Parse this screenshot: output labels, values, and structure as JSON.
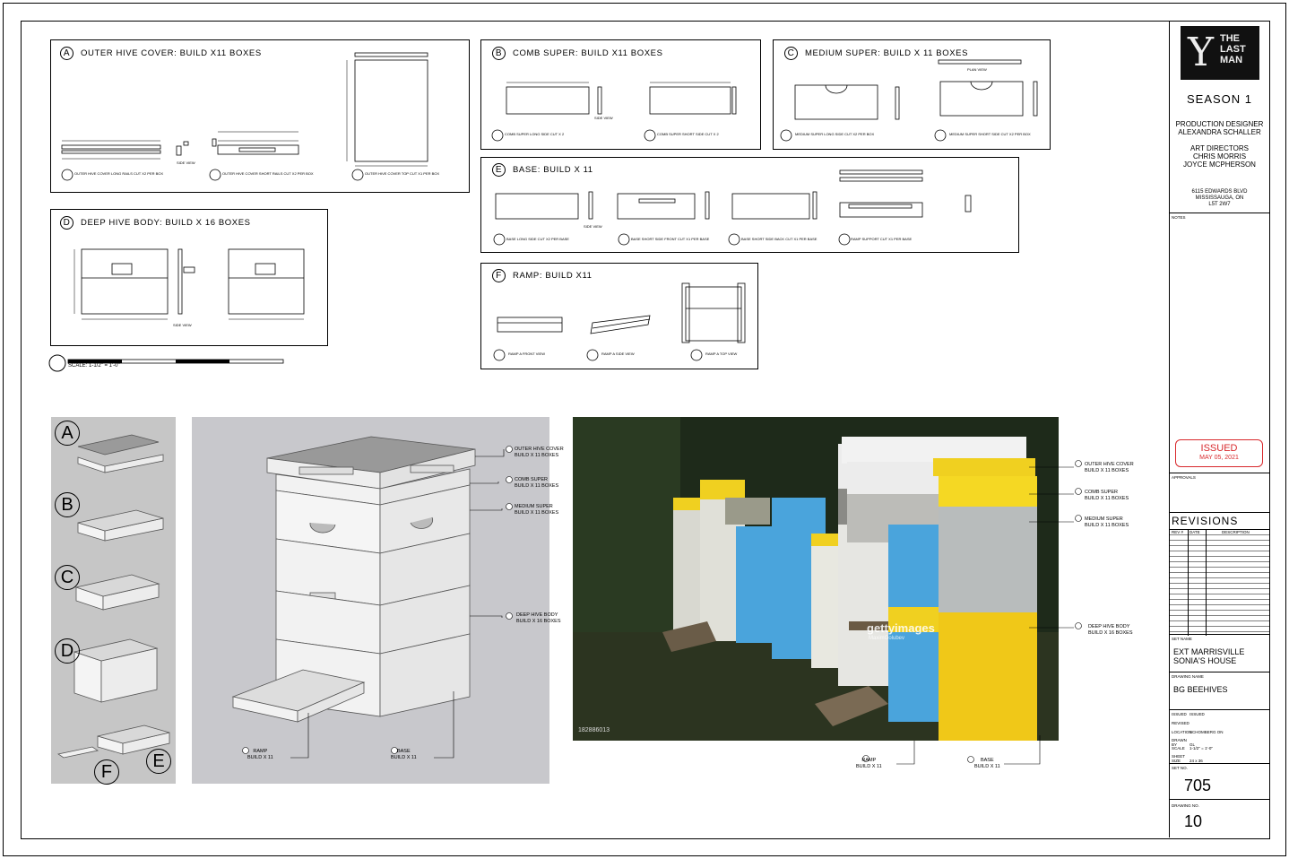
{
  "panels": {
    "a": {
      "letter": "A",
      "title": "OUTER HIVE COVER: BUILD X11 BOXES",
      "captions": [
        "OUTER HIVE COVER LONG RAILS CUT X2 PER BOX",
        "OUTER HIVE COVER SHORT RAILS CUT X2 PER BOX",
        "OUTER HIVE COVER TOP CUT X1 PER BOX"
      ],
      "side_view": "SIDE VIEW"
    },
    "b": {
      "letter": "B",
      "title": "COMB SUPER:  BUILD X11 BOXES",
      "captions": [
        "COMB SUPER LONG SIDE CUT X 2",
        "COMB SUPER SHORT SIDE CUT X 2"
      ],
      "side_view": "SIDE VIEW"
    },
    "c": {
      "letter": "C",
      "title": "MEDIUM SUPER: BUILD X 11 BOXES",
      "captions": [
        "MEDIUM SUPER LONG SIDE CUT X2 PER BOX",
        "MEDIUM SUPER SHORT SIDE CUT X2 PER BOX"
      ],
      "plan_view": "PLAN VIEW",
      "side_view": "SIDE VIEW"
    },
    "d": {
      "letter": "D",
      "title": "DEEP HIVE BODY: BUILD X 16 BOXES",
      "side_view": "SIDE VIEW"
    },
    "e": {
      "letter": "E",
      "title": "BASE:  BUILD X 11",
      "captions": [
        "BASE LONG SIDE CUT X2 PER BASE",
        "BASE SHORT SIDE FRONT CUT X1 PER BASE",
        "BASE SHORT SIDE BACK CUT X1 PER BASE",
        "RAMP SUPPORT CUT X1 PER BASE"
      ],
      "side_view": "SIDE VIEW"
    },
    "f": {
      "letter": "F",
      "title": "RAMP:  BUILD X11",
      "captions": [
        "RAMP A FRONT VIEW",
        "RAMP A SIDE VIEW",
        "RAMP A TOP VIEW"
      ]
    }
  },
  "scale_text": "SCALE: 1-1/2\" = 1'-0\"",
  "legend_letters": [
    "A",
    "B",
    "C",
    "D",
    "E",
    "F"
  ],
  "model_labels": {
    "outer_cover": [
      "OUTER HIVE COVER",
      "BUILD X 11 BOXES"
    ],
    "comb_super": [
      "COMB SUPER",
      "BUILD X 11 BOXES"
    ],
    "medium_super": [
      "MEDIUM SUPER",
      "BUILD X 11 BOXES"
    ],
    "deep_body": [
      "DEEP HIVE BODY",
      "BUILD X 16 BOXES"
    ],
    "ramp": [
      "RAMP",
      "BUILD X 11"
    ],
    "base": [
      "BASE",
      "BUILD X 11"
    ]
  },
  "photo": {
    "watermark": "gettyimages",
    "credit": "MaximGolubev",
    "id": "182886013"
  },
  "title_block": {
    "logo": [
      "THE",
      "LAST",
      "MAN"
    ],
    "season": "SEASON 1",
    "production_designer_label": "PRODUCTION DESIGNER",
    "production_designer": "ALEXANDRA SCHALLER",
    "art_directors_label": "ART DIRECTORS",
    "art_directors": [
      "CHRIS MORRIS",
      "JOYCE MCPHERSON"
    ],
    "address": [
      "6115 EDWARDS BLVD",
      "MISSISSAUGA, ON",
      "L5T 2W7"
    ],
    "notes_label": "NOTES",
    "issued_stamp": "ISSUED",
    "issued_date": "MAY 05, 2021",
    "approvals_label": "APPROVALS",
    "revisions_label": "REVISIONS",
    "rev_cols": [
      "REV #",
      "DATE",
      "DESCRIPTION"
    ],
    "set_name_label": "SET NAME",
    "set_name": [
      "EXT MARRISVILLE",
      "SONIA'S HOUSE"
    ],
    "drawing_name_label": "DRAWING NAME",
    "drawing_name": "BG BEEHIVES",
    "info": [
      [
        "ISSUED",
        "ISSUED"
      ],
      [
        "REVISED",
        ""
      ],
      [
        "LOCATION",
        "SCHOMBERG ON"
      ],
      [
        "DRAWN BY",
        "GL"
      ],
      [
        "SCALE",
        "1-1/2\" = 1'-0\""
      ],
      [
        "SHEET SIZE",
        "24 x 36"
      ]
    ],
    "set_no_label": "SET NO.",
    "set_no": "705",
    "drawing_no_label": "DRAWING NO.",
    "drawing_no": "10"
  },
  "colors": {
    "yellow": "#f0d020",
    "blue": "#4aa4dc",
    "grey": "#a8aeb0",
    "white": "#e8e8e8",
    "model_bg": "#c8c8cc"
  }
}
